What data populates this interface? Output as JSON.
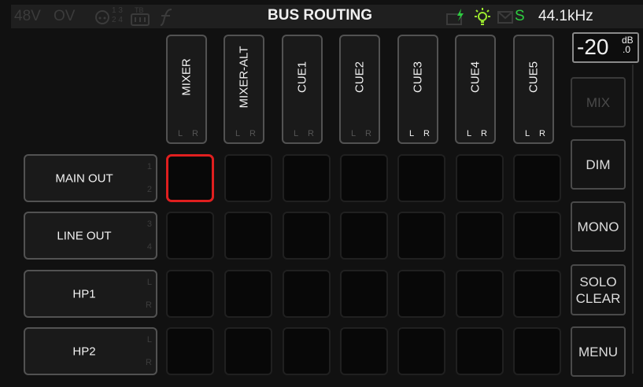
{
  "status_bar": {
    "phantom_power": "48V",
    "overload": "OV",
    "channel_digits": "1 3",
    "channel_digits_2": "2 4",
    "tb_label": "TB",
    "title": "BUS ROUTING",
    "sync_letter": "S",
    "sample_rate": "44.1kHz",
    "icons": [
      "headphone-icon",
      "talkback-mic-icon",
      "fx-icon",
      "battery-charging-icon",
      "lightbulb-icon",
      "mail-icon"
    ],
    "colors": {
      "charge": "#2ecc40",
      "sync": "#2ecc40",
      "light": "#9be82e"
    }
  },
  "level": {
    "value": "-20",
    "unit": "dB",
    "decimal": ".0"
  },
  "columns": [
    {
      "label": "MIXER",
      "left": "L",
      "right": "R",
      "lr_active": false
    },
    {
      "label": "MIXER-ALT",
      "left": "L",
      "right": "R",
      "lr_active": false
    },
    {
      "label": "CUE1",
      "left": "L",
      "right": "R",
      "lr_active": false
    },
    {
      "label": "CUE2",
      "left": "L",
      "right": "R",
      "lr_active": false
    },
    {
      "label": "CUE3",
      "left": "L",
      "right": "R",
      "lr_active": true
    },
    {
      "label": "CUE4",
      "left": "L",
      "right": "R",
      "lr_active": true
    },
    {
      "label": "CUE5",
      "left": "L",
      "right": "R",
      "lr_active": true
    }
  ],
  "rows": [
    {
      "label": "MAIN OUT",
      "ch1": "1",
      "ch2": "2"
    },
    {
      "label": "LINE OUT",
      "ch1": "3",
      "ch2": "4"
    },
    {
      "label": "HP1",
      "ch1": "L",
      "ch2": "R"
    },
    {
      "label": "HP2",
      "ch1": "L",
      "ch2": "R"
    }
  ],
  "selected_cell": {
    "row": 0,
    "col": 0
  },
  "side_buttons": [
    {
      "label": "MIX",
      "enabled": false
    },
    {
      "label": "DIM",
      "enabled": true
    },
    {
      "label": "MONO",
      "enabled": true
    },
    {
      "label": "SOLO\nCLEAR",
      "enabled": true
    },
    {
      "label": "MENU",
      "enabled": true
    }
  ]
}
